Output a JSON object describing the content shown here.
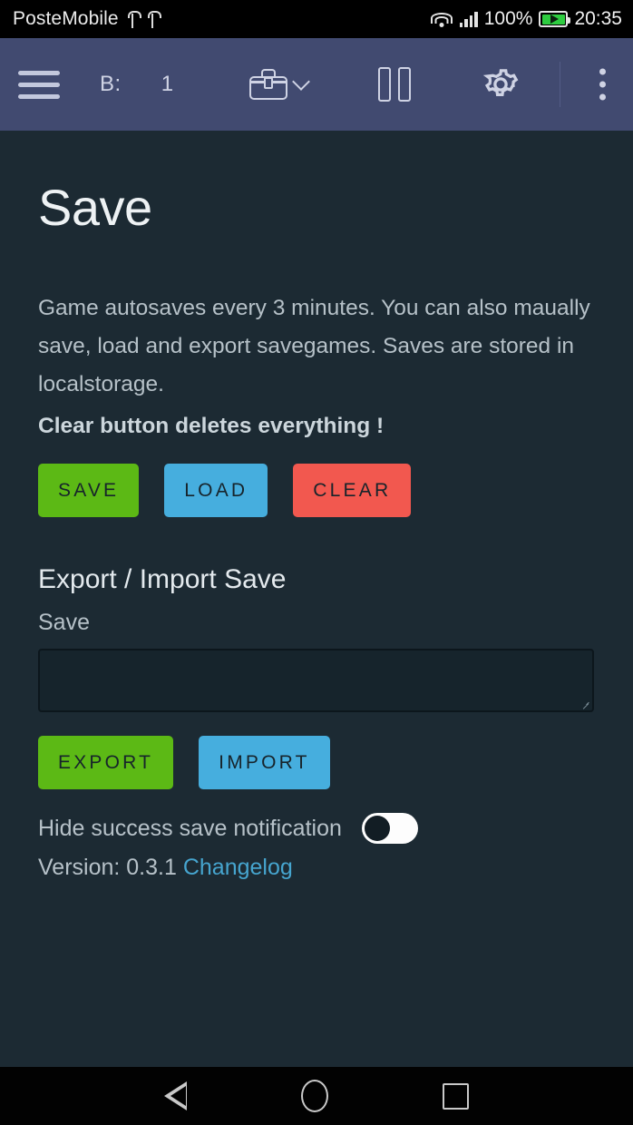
{
  "statusbar": {
    "carrier": "PosteMobile",
    "usb_icon_1": "usb-icon",
    "usb_icon_2": "usb-icon",
    "wifi_icon": "wifi-icon",
    "signal_icon": "cellular-signal-icon",
    "battery_percent": "100%",
    "battery_icon": "battery-charging-icon",
    "clock": "20:35"
  },
  "toolbar": {
    "menu_icon": "hamburger-menu-icon",
    "counter_label": "B:",
    "counter_value": "1",
    "toolbox_icon": "toolbox-icon",
    "toolbox_chevron": "chevron-down-icon",
    "pause_icon": "pause-icon",
    "settings_icon": "gear-icon",
    "overflow_icon": "three-dot-menu-icon",
    "background_color": "#414a70"
  },
  "main": {
    "page_title": "Save",
    "description": "Game autosaves every 3 minutes. You can also maually save, load and export savegames. Saves are stored in localstorage.",
    "warning": "Clear button deletes everything !",
    "actions": [
      {
        "label": "SAVE",
        "color": "#5cb915"
      },
      {
        "label": "LOAD",
        "color": "#46aede"
      },
      {
        "label": "CLEAR",
        "color": "#f2584f"
      }
    ],
    "export_section_title": "Export / Import Save",
    "save_field_label": "Save",
    "save_textarea_value": "",
    "save_textarea_placeholder": "",
    "transfer_actions": [
      {
        "label": "EXPORT",
        "color": "#5cb915"
      },
      {
        "label": "IMPORT",
        "color": "#46aede"
      }
    ],
    "hide_notification_label": "Hide success save notification",
    "hide_notification_state": "off",
    "version_text": "Version: 0.3.1",
    "changelog_link": "Changelog",
    "link_color": "#46a5cf",
    "background_color": "#1c2a33"
  },
  "navbar": {
    "back_icon": "back-triangle-icon",
    "home_icon": "home-circle-icon",
    "recents_icon": "recents-square-icon"
  }
}
